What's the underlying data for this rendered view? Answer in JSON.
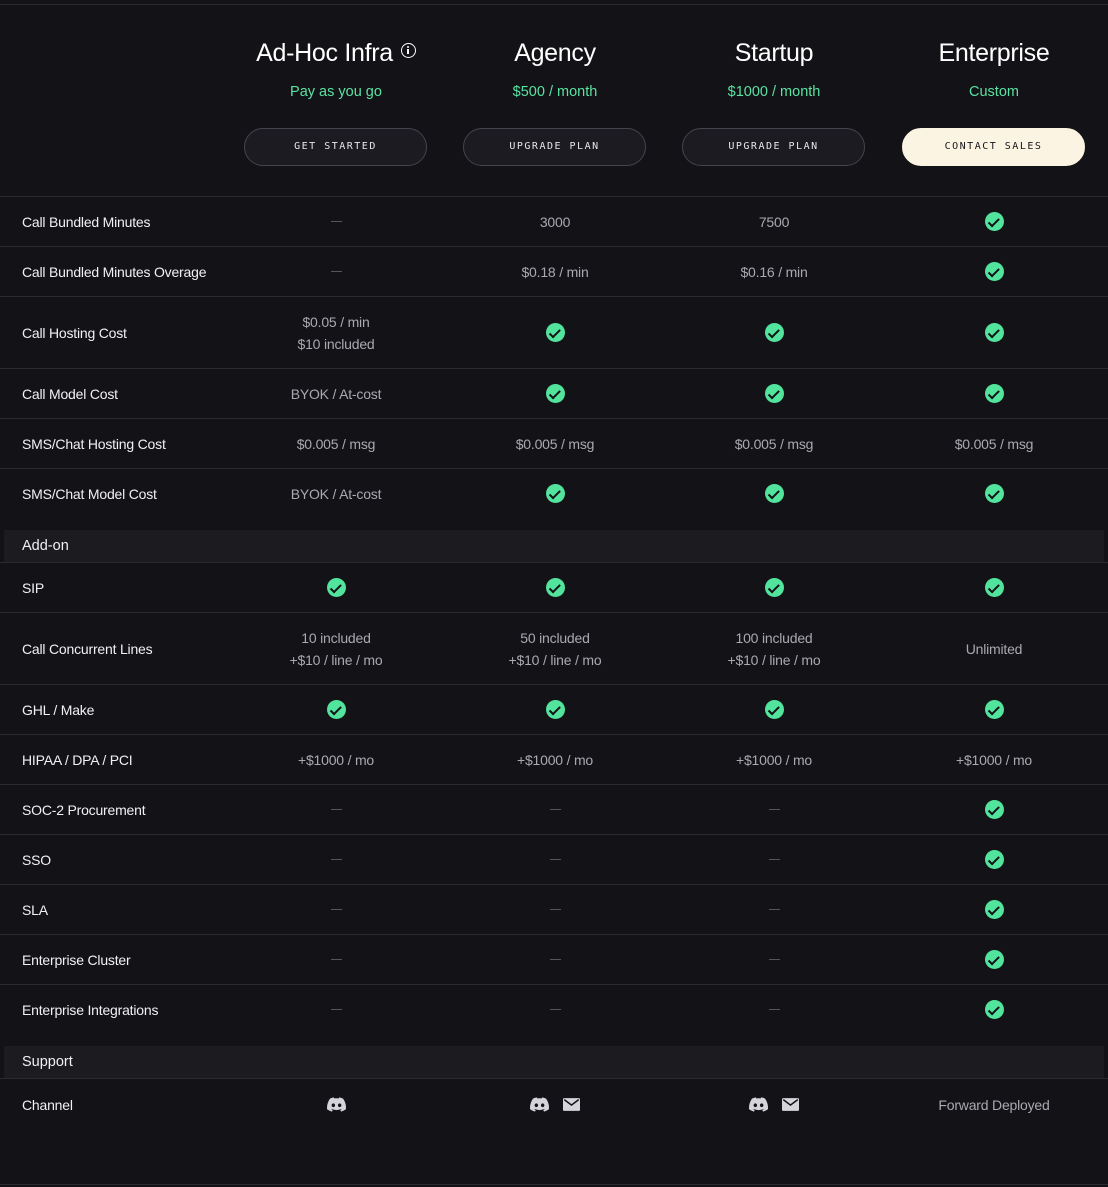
{
  "plans": [
    {
      "name": "Ad-Hoc Infra",
      "price": "Pay as you go",
      "button": "GET STARTED",
      "info_icon": "info-icon"
    },
    {
      "name": "Agency",
      "price": "$500 / month",
      "button": "UPGRADE PLAN"
    },
    {
      "name": "Startup",
      "price": "$1000 / month",
      "button": "UPGRADE PLAN"
    },
    {
      "name": "Enterprise",
      "price": "Custom",
      "button": "CONTACT SALES"
    }
  ],
  "colors": {
    "accent_green": "#52e39d",
    "primary_button": "#fbf4e2",
    "background": "#131217"
  },
  "sections": {
    "addon": "Add-on",
    "support": "Support"
  },
  "rows": {
    "bundled_minutes": {
      "label": "Call Bundled Minutes",
      "values": [
        "—",
        "3000",
        "7500",
        "check"
      ]
    },
    "bundled_overage": {
      "label": "Call Bundled Minutes Overage",
      "values": [
        "—",
        "$0.18 / min",
        "$0.16 / min",
        "check"
      ]
    },
    "hosting_cost": {
      "label": "Call Hosting Cost",
      "values": [
        [
          "$0.05 / min",
          "$10 included"
        ],
        "check",
        "check",
        "check"
      ]
    },
    "model_cost": {
      "label": "Call Model Cost",
      "values": [
        "BYOK / At-cost",
        "check",
        "check",
        "check"
      ]
    },
    "sms_hosting": {
      "label": "SMS/Chat Hosting Cost",
      "values": [
        "$0.005 / msg",
        "$0.005 / msg",
        "$0.005 / msg",
        "$0.005 / msg"
      ]
    },
    "sms_model": {
      "label": "SMS/Chat Model Cost",
      "values": [
        "BYOK / At-cost",
        "check",
        "check",
        "check"
      ]
    },
    "sip": {
      "label": "SIP",
      "values": [
        "check",
        "check",
        "check",
        "check"
      ]
    },
    "concurrent": {
      "label": "Call Concurrent Lines",
      "values": [
        [
          "10 included",
          "+$10 / line / mo"
        ],
        [
          "50 included",
          "+$10 / line / mo"
        ],
        [
          "100 included",
          "+$10 / line / mo"
        ],
        "Unlimited"
      ]
    },
    "ghl": {
      "label": "GHL / Make",
      "values": [
        "check",
        "check",
        "check",
        "check"
      ]
    },
    "hipaa": {
      "label": "HIPAA / DPA / PCI",
      "values": [
        "+$1000 / mo",
        "+$1000 / mo",
        "+$1000 / mo",
        "+$1000 / mo"
      ]
    },
    "soc2": {
      "label": "SOC-2 Procurement",
      "values": [
        "—",
        "—",
        "—",
        "check"
      ]
    },
    "sso": {
      "label": "SSO",
      "values": [
        "—",
        "—",
        "—",
        "check"
      ]
    },
    "sla": {
      "label": "SLA",
      "values": [
        "—",
        "—",
        "—",
        "check"
      ]
    },
    "cluster": {
      "label": "Enterprise Cluster",
      "values": [
        "—",
        "—",
        "—",
        "check"
      ]
    },
    "integrations": {
      "label": "Enterprise Integrations",
      "values": [
        "—",
        "—",
        "—",
        "check"
      ]
    },
    "channel": {
      "label": "Channel",
      "values": [
        [
          "discord-icon"
        ],
        [
          "discord-icon",
          "mail-icon"
        ],
        [
          "discord-icon",
          "mail-icon"
        ],
        "Forward Deployed"
      ]
    }
  }
}
